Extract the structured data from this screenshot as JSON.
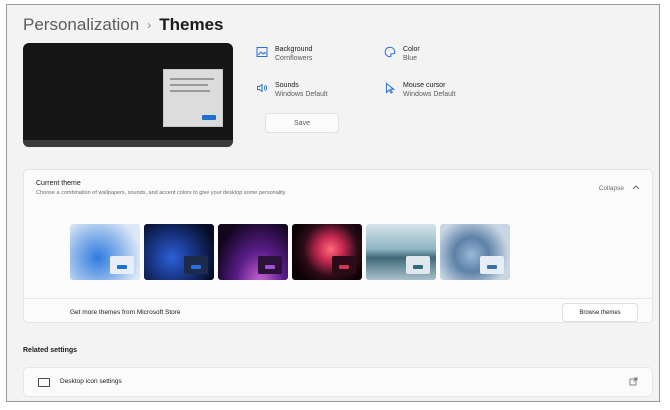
{
  "breadcrumb": {
    "parent": "Personalization",
    "separator": "›",
    "current": "Themes"
  },
  "theme_properties": {
    "background": {
      "label": "Background",
      "value": "Cornflowers"
    },
    "color": {
      "label": "Color",
      "value": "Blue"
    },
    "sounds": {
      "label": "Sounds",
      "value": "Windows Default"
    },
    "mouse_cursor": {
      "label": "Mouse cursor",
      "value": "Windows Default"
    },
    "save_label": "Save"
  },
  "current_theme": {
    "title": "Current theme",
    "description": "Choose a combination of wallpapers, sounds, and accent colors to give your desktop some personality",
    "collapse_label": "Collapse",
    "collapse_icon": "chevron-up-icon",
    "themes": [
      {
        "name": "windows-light",
        "accent": "#1f6fd1",
        "mini_bg": "#e8eef6"
      },
      {
        "name": "windows-dark",
        "accent": "#2c6be0",
        "mini_bg": "#1e2a4a"
      },
      {
        "name": "glow",
        "accent": "#a04fd0",
        "mini_bg": "#2a1238"
      },
      {
        "name": "captured-motion",
        "accent": "#d1344c",
        "mini_bg": "#2b0b18"
      },
      {
        "name": "sunrise",
        "accent": "#2f6b7d",
        "mini_bg": "#dfe8ec"
      },
      {
        "name": "flow",
        "accent": "#3d6fa3",
        "mini_bg": "#e6edf4"
      }
    ],
    "store_text": "Get more themes from Microsoft Store",
    "browse_label": "Browse themes"
  },
  "related_settings": {
    "title": "Related settings",
    "items": [
      {
        "label": "Desktop icon settings",
        "icon": "monitor-icon",
        "trailing_icon": "open-external-icon"
      }
    ]
  }
}
